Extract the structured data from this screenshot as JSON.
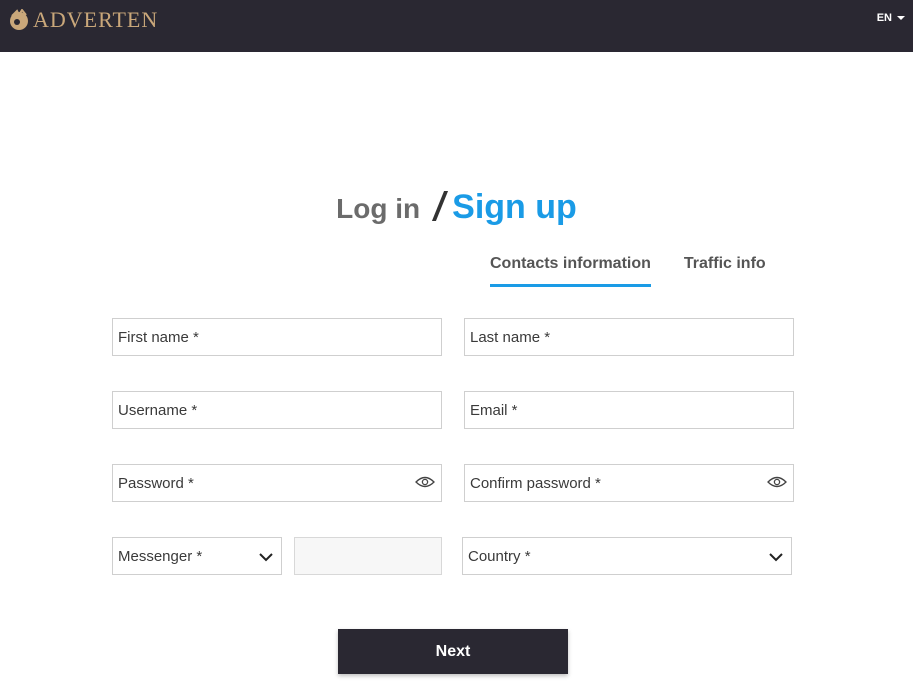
{
  "header": {
    "brand": "ADVERTEN",
    "language": "EN"
  },
  "auth": {
    "login_label": "Log in",
    "signup_label": "Sign up"
  },
  "tabs": [
    {
      "label": "Contacts information",
      "active": true
    },
    {
      "label": "Traffic info",
      "active": false
    }
  ],
  "form": {
    "first_name": "First name *",
    "last_name": "Last name *",
    "username": "Username *",
    "email": "Email *",
    "password": "Password *",
    "confirm_password": "Confirm password *",
    "messenger": "Messenger *",
    "messenger_handle": "",
    "country": "Country *"
  },
  "actions": {
    "next_label": "Next"
  },
  "colors": {
    "header_bg": "#2a2832",
    "brand_gold": "#c9a77a",
    "accent_blue": "#1a9be6"
  }
}
